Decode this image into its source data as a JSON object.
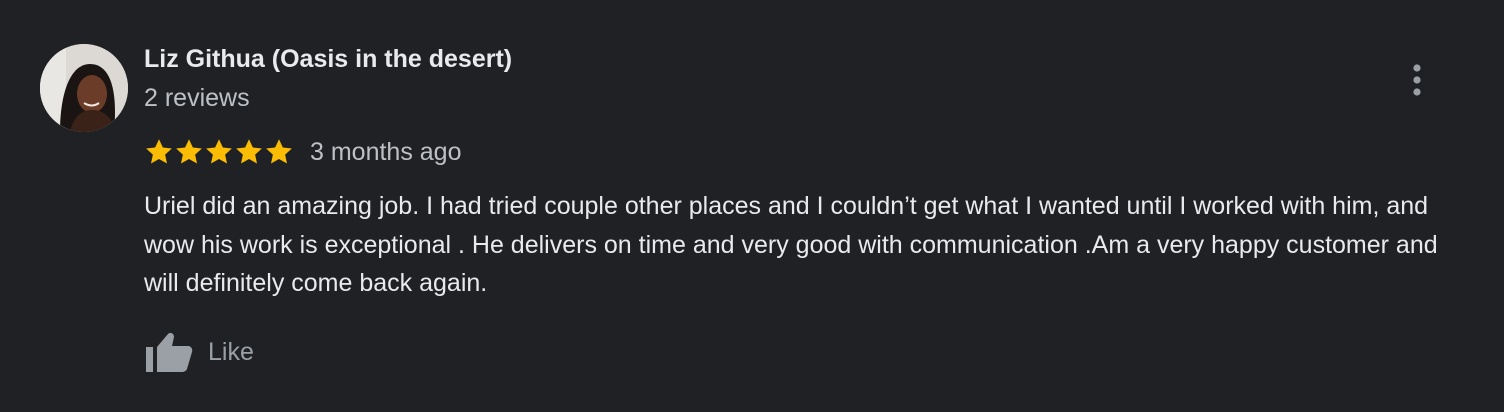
{
  "review": {
    "author_name": "Liz Githua (Oasis in the desert)",
    "review_count": "2 reviews",
    "rating": 5,
    "rating_max": 5,
    "time_ago": "3 months ago",
    "text": "Uriel did an amazing job. I had tried couple other places and I couldn’t get what I wanted until I worked with him, and wow his work is exceptional . He delivers on time and very good with communication .Am a very happy customer and will definitely come back again.",
    "like_label": "Like"
  },
  "icons": {
    "avatar": "profile-photo",
    "menu": "more-vertical-icon",
    "star": "star-icon",
    "like": "thumbs-up-icon"
  },
  "colors": {
    "background": "#202124",
    "star": "#fbbc04",
    "primary_text": "#e8eaed",
    "secondary_text": "#bdc1c6",
    "icon": "#9aa0a6"
  }
}
